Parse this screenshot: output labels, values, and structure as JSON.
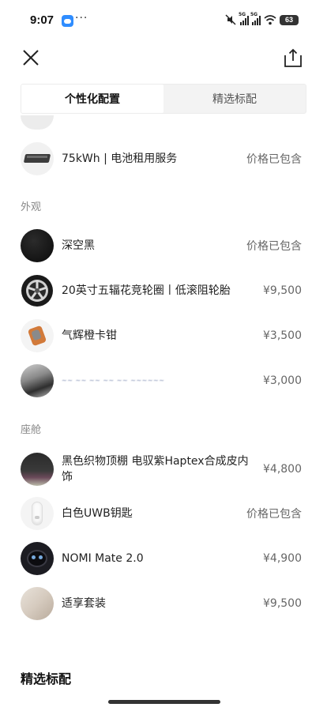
{
  "status": {
    "time": "9:07",
    "dots": "···",
    "battery": "63"
  },
  "tabs": [
    {
      "label": "个性化配置",
      "active": true
    },
    {
      "label": "精选标配",
      "active": false
    }
  ],
  "battery_row": {
    "name": "75kWh | 电池租用服务",
    "price": "价格已包含"
  },
  "exterior": {
    "header": "外观",
    "items": [
      {
        "name": "深空黑",
        "price": "价格已包含"
      },
      {
        "name": "20英寸五辐花竞轮圈丨低滚阻轮胎",
        "price": "¥9,500"
      },
      {
        "name": "气辉橙卡钳",
        "price": "¥3,500"
      },
      {
        "name": "~~ ~~ ~~ ~~ ~~ ~~~~~~",
        "price": "¥3,000"
      }
    ]
  },
  "cabin": {
    "header": "座舱",
    "items": [
      {
        "name": "黑色织物顶棚 电驭紫Haptex合成皮内饰",
        "price": "¥4,800"
      },
      {
        "name": "白色UWB钥匙",
        "price": "价格已包含"
      },
      {
        "name": "NOMI Mate 2.0",
        "price": "¥4,900"
      },
      {
        "name": "适享套装",
        "price": "¥9,500"
      }
    ]
  },
  "bottom_section": {
    "title": "精选标配"
  }
}
